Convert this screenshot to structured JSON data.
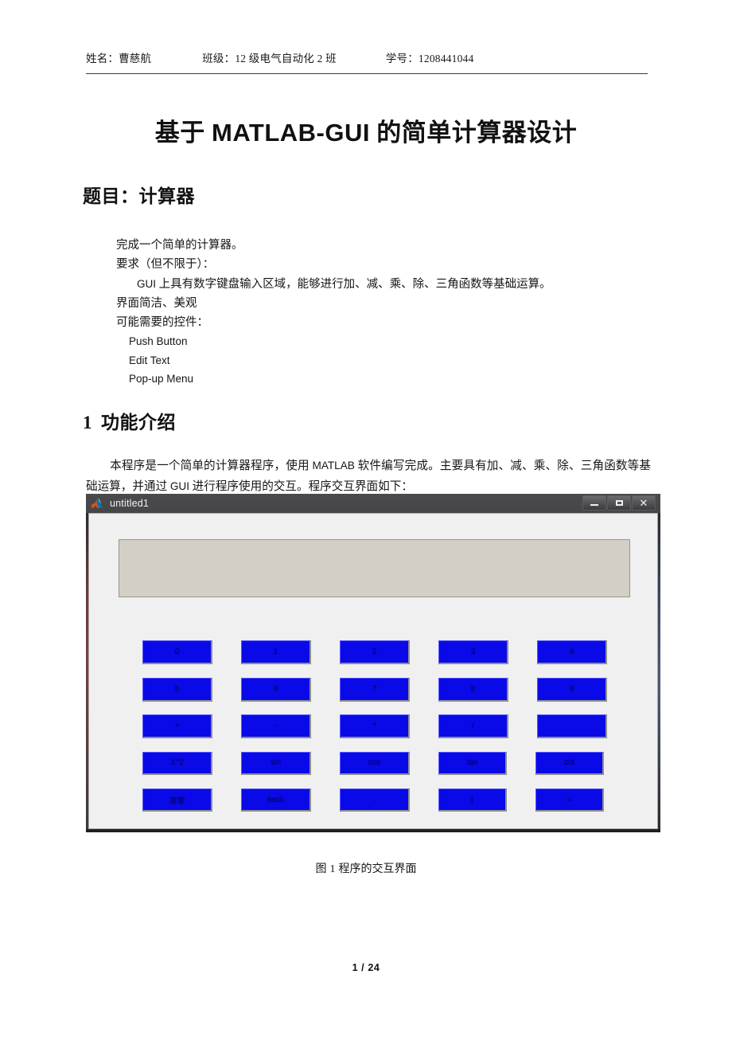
{
  "header": {
    "name_label": "姓名：",
    "name_value": "曹慈航",
    "class_label": "班级：",
    "class_value": "12 级电气自动化 2 班",
    "id_label": "学号：",
    "id_value": "1208441044"
  },
  "title": {
    "prefix": "基于 ",
    "latin": "MATLAB-GUI",
    "suffix": " 的简单计算器设计"
  },
  "subject_heading": "题目：计算器",
  "requirements": {
    "line1": "完成一个简单的计算器。",
    "line2": "要求（但不限于）：",
    "line3_latin": "GUI",
    "line3_rest": " 上具有数字键盘输入区域，能够进行加、减、乘、除、三角函数等基础运算。",
    "line4": "界面简洁、美观",
    "line5": "可能需要的控件：",
    "controls": [
      "Push Button",
      "Edit Text",
      "Pop-up Menu"
    ]
  },
  "section1": {
    "number": "1",
    "heading": "功能介绍",
    "para_a": "本程序是一个简单的计算器程序，使用 ",
    "para_b": "MATLAB",
    "para_c": " 软件编写完成。主要具有加、减、乘、除、三角函数等基础运算，并通过 ",
    "para_d": "GUI",
    "para_e": " 进行程序使用的交互。程序交互界面如下："
  },
  "gui": {
    "window_title": "untitled1",
    "icon": "matlab-icon",
    "minimize_label": "—",
    "maximize_label": "□",
    "close_label": "✕",
    "display_value": "",
    "accent_color": "#0a0ae8",
    "keypad": [
      [
        "0",
        "1",
        "2",
        "3",
        "4"
      ],
      [
        "5",
        "6",
        "7",
        "8",
        "9"
      ],
      [
        "+",
        "-",
        "*",
        "/",
        ""
      ],
      [
        "X^2",
        "sin",
        "cos",
        "tan",
        "cot"
      ],
      [
        "清零",
        "back",
        ".",
        "(",
        "="
      ]
    ]
  },
  "figure_caption": {
    "label": "图",
    "number": "1",
    "text": "程序的交互界面"
  },
  "footer": {
    "page": "1 / 24"
  }
}
